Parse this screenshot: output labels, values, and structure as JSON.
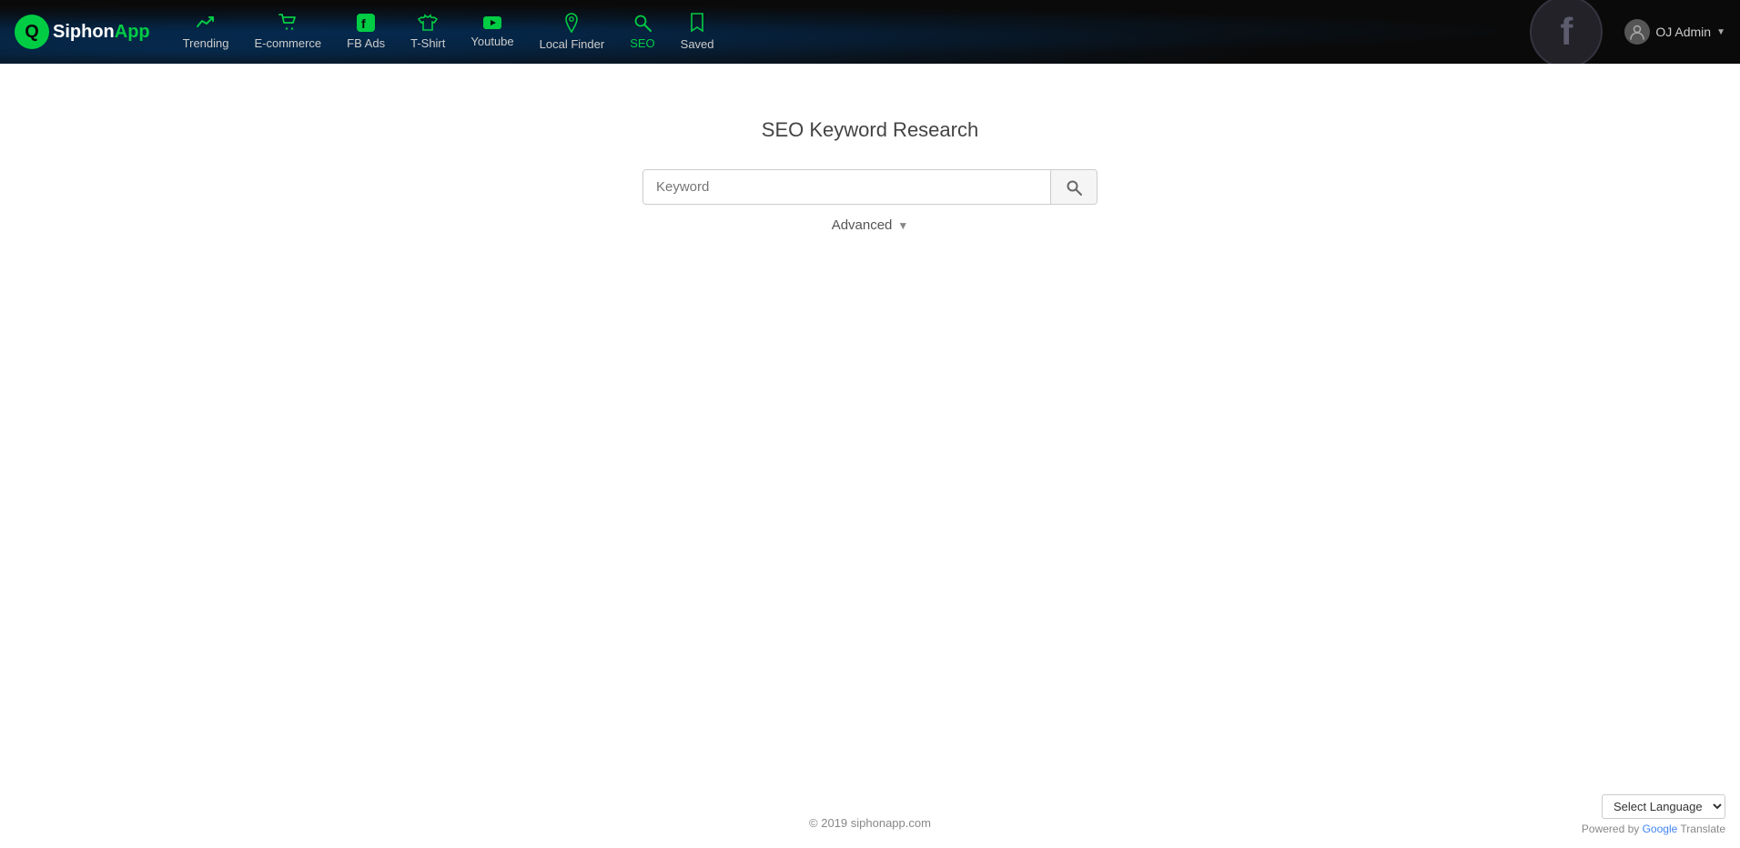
{
  "app": {
    "logo_siphon": "Siphon",
    "logo_app": "App"
  },
  "navbar": {
    "items": [
      {
        "id": "trending",
        "label": "Trending",
        "icon": "📈",
        "active": false
      },
      {
        "id": "ecommerce",
        "label": "E-commerce",
        "icon": "🛒",
        "active": false
      },
      {
        "id": "fb-ads",
        "label": "FB Ads",
        "icon": "f",
        "active": false,
        "iconType": "fb"
      },
      {
        "id": "tshirt",
        "label": "T-Shirt",
        "icon": "👕",
        "active": false
      },
      {
        "id": "youtube",
        "label": "Youtube",
        "icon": "▶",
        "active": false,
        "iconType": "yt"
      },
      {
        "id": "local-finder",
        "label": "Local Finder",
        "icon": "📍",
        "active": false
      },
      {
        "id": "seo",
        "label": "SEO",
        "icon": "⚙",
        "active": true,
        "iconType": "seo"
      },
      {
        "id": "saved",
        "label": "Saved",
        "icon": "🔖",
        "active": false
      }
    ],
    "user": {
      "name": "OJ Admin",
      "caret": "▼"
    }
  },
  "main": {
    "title": "SEO Keyword Research",
    "search_placeholder": "Keyword",
    "search_button_label": "Search",
    "advanced_label": "Advanced",
    "advanced_caret": "▼"
  },
  "footer": {
    "copyright": "© 2019 siphonapp.com"
  },
  "footer_bottom": {
    "select_language_label": "Select Language",
    "powered_text": "Powered by ",
    "google_text": "Google",
    "translate_text": " Translate"
  }
}
